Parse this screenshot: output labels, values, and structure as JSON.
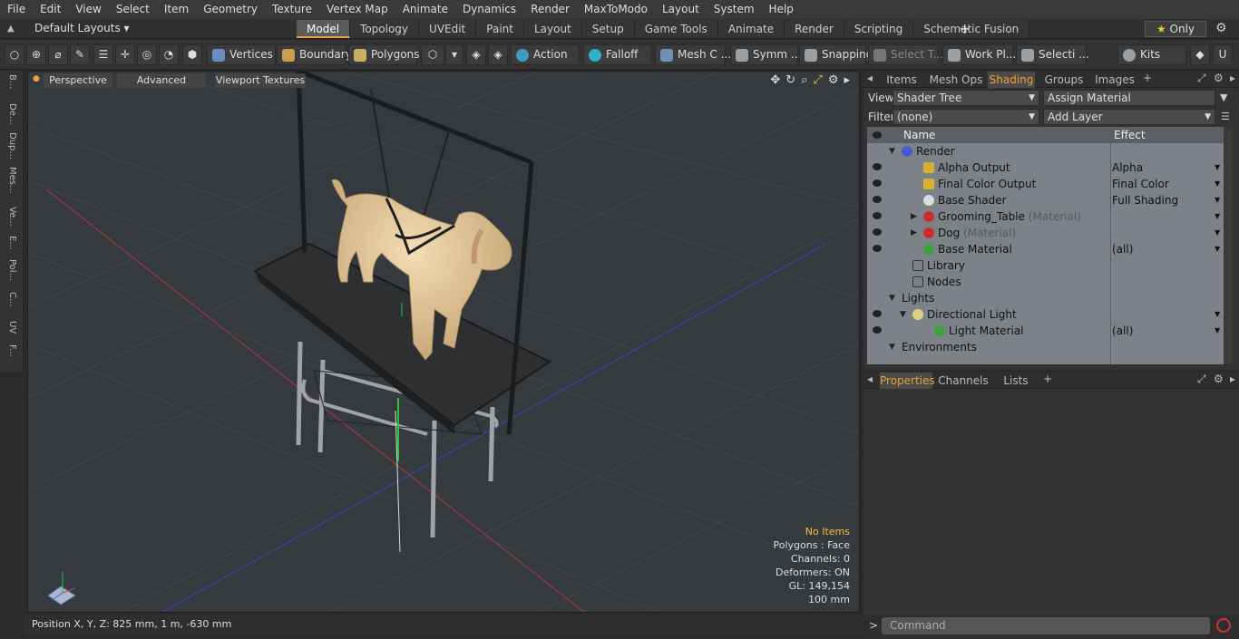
{
  "menu": [
    "File",
    "Edit",
    "View",
    "Select",
    "Item",
    "Geometry",
    "Texture",
    "Vertex Map",
    "Animate",
    "Dynamics",
    "Render",
    "MaxToModo",
    "Layout",
    "System",
    "Help"
  ],
  "layoutbar": {
    "layout_selector": "Default Layouts",
    "tabs": [
      "Model",
      "Topology",
      "UVEdit",
      "Paint",
      "Layout",
      "Setup",
      "Game Tools",
      "Animate",
      "Render",
      "Scripting",
      "Schematic Fusion"
    ],
    "only_label": "Only"
  },
  "toolbar": {
    "vertices": "Vertices",
    "boundary": "Boundary",
    "polygons": "Polygons",
    "action": "Action",
    "falloff": "Falloff",
    "mesh": "Mesh C ...",
    "symm": "Symm ...",
    "snapping": "Snapping",
    "select_t": "Select T...",
    "work_pl": "Work Pl...",
    "selecti": "Selecti ...",
    "kits": "Kits"
  },
  "left_tabs": [
    "B...",
    "De...",
    "Dup...",
    "Mes...",
    "Ve...",
    "E...",
    "Pol...",
    "C...",
    "UV",
    "F..."
  ],
  "viewport": {
    "perspective": "Perspective",
    "advanced": "Advanced",
    "textures": "Viewport Textures",
    "info": {
      "selection": "No Items",
      "polygons": "Polygons : Face",
      "channels": "Channels: 0",
      "deformers": "Deformers: ON",
      "gl": "GL: 149,154",
      "scale": "100 mm"
    }
  },
  "status": "Position X, Y, Z:  825 mm, 1 m, -630 mm",
  "shading_panel": {
    "tabs": [
      "Items",
      "Mesh Ops",
      "Shading",
      "Groups",
      "Images"
    ],
    "view_label": "View",
    "view_value": "Shader Tree",
    "assign": "Assign Material",
    "filter_label": "Filter",
    "filter_value": "(none)",
    "add_layer": "Add Layer",
    "col_name": "Name",
    "col_effect": "Effect",
    "rows": [
      {
        "name": "Render",
        "effect": "",
        "eye": false,
        "indent": 0,
        "icon": "sphere-icon",
        "color": "#4a5ad0"
      },
      {
        "name": "Alpha Output",
        "effect": "Alpha",
        "eye": true,
        "indent": 2,
        "icon": "output-icon",
        "color": "#d8b030"
      },
      {
        "name": "Final Color Output",
        "effect": "Final Color",
        "eye": true,
        "indent": 2,
        "icon": "output-icon",
        "color": "#d8b030"
      },
      {
        "name": "Base Shader",
        "effect": "Full Shading",
        "eye": true,
        "indent": 2,
        "icon": "shader-icon",
        "color": "#dddddd"
      },
      {
        "name": "Grooming_Table",
        "suffix": "(Material)",
        "effect": "",
        "eye": true,
        "indent": 2,
        "icon": "material-icon",
        "color": "#c83030"
      },
      {
        "name": "Dog",
        "suffix": "(Material)",
        "effect": "",
        "eye": true,
        "indent": 2,
        "icon": "material-icon",
        "color": "#c83030"
      },
      {
        "name": "Base Material",
        "effect": "(all)",
        "eye": true,
        "indent": 2,
        "icon": "material-icon",
        "color": "#40a040"
      },
      {
        "name": "Library",
        "effect": "",
        "eye": false,
        "indent": 1,
        "icon": "folder-icon",
        "color": "#cccccc"
      },
      {
        "name": "Nodes",
        "effect": "",
        "eye": false,
        "indent": 1,
        "icon": "folder-icon",
        "color": "#cccccc"
      },
      {
        "name": "Lights",
        "effect": "",
        "eye": false,
        "indent": 0,
        "icon": "",
        "color": ""
      },
      {
        "name": "Directional Light",
        "effect": "",
        "eye": true,
        "indent": 1,
        "icon": "light-icon",
        "color": "#e0d080"
      },
      {
        "name": "Light Material",
        "effect": "(all)",
        "eye": true,
        "indent": 3,
        "icon": "material-icon",
        "color": "#40a040"
      },
      {
        "name": "Environments",
        "effect": "",
        "eye": false,
        "indent": 0,
        "icon": "",
        "color": ""
      }
    ]
  },
  "properties_panel": {
    "tabs": [
      "Properties",
      "Channels",
      "Lists"
    ]
  },
  "command": {
    "prompt": ">",
    "placeholder": "Command"
  }
}
